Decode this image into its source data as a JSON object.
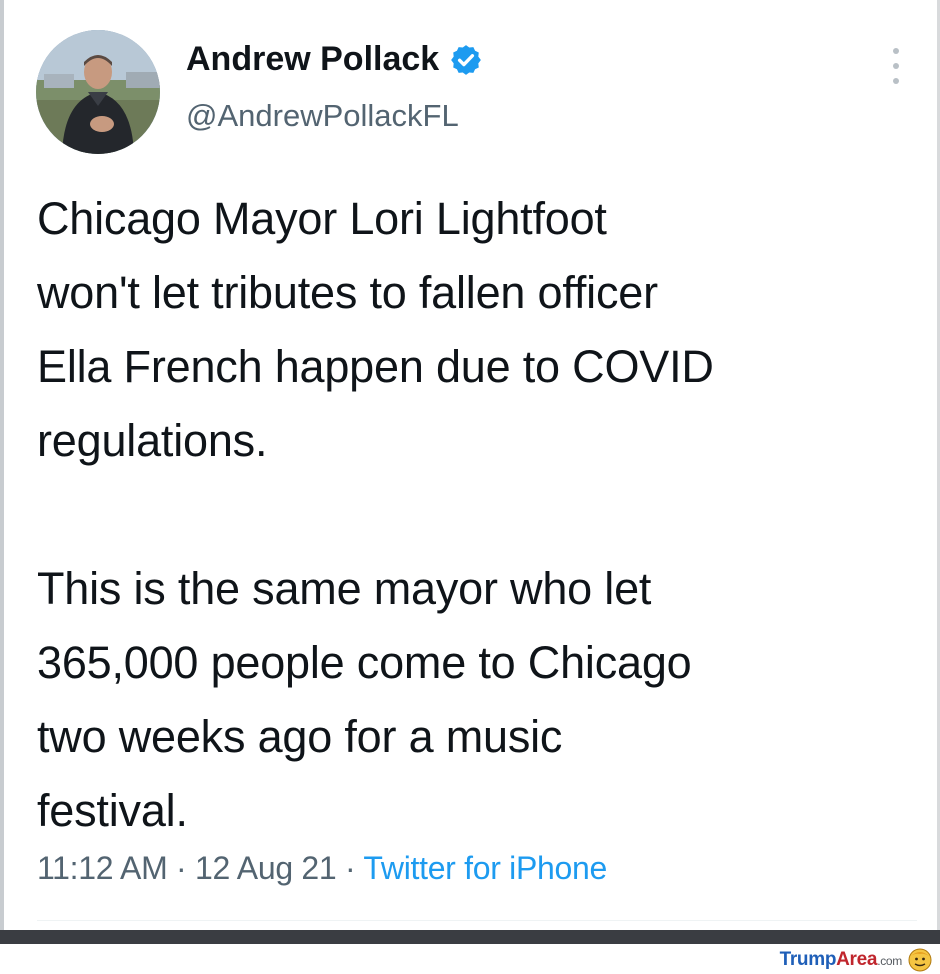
{
  "tweet": {
    "author": {
      "display_name": "Andrew Pollack",
      "handle": "@AndrewPollackFL",
      "verified": true
    },
    "text_lines_p1": [
      "Chicago Mayor Lori Lightfoot",
      "won't let tributes to fallen officer",
      "Ella French happen due to COVID",
      "regulations."
    ],
    "text_lines_p2": [
      "This is the same mayor who let",
      "365,000 people come to Chicago",
      "two weeks ago for a music",
      "festival."
    ],
    "time": "11:12 AM",
    "separator": " · ",
    "date": "12 Aug 21",
    "source": "Twitter for iPhone"
  },
  "watermark": {
    "part1": "Trump",
    "part2": "Area",
    "part3": ".com"
  },
  "icons": {
    "verified": "verified-badge-icon",
    "more": "more-vertical-icon",
    "watermark_face": "trump-face-icon"
  },
  "colors": {
    "text": "#0f1419",
    "secondary": "#536471",
    "link": "#1d9bf0",
    "verified": "#1d9bf0"
  }
}
